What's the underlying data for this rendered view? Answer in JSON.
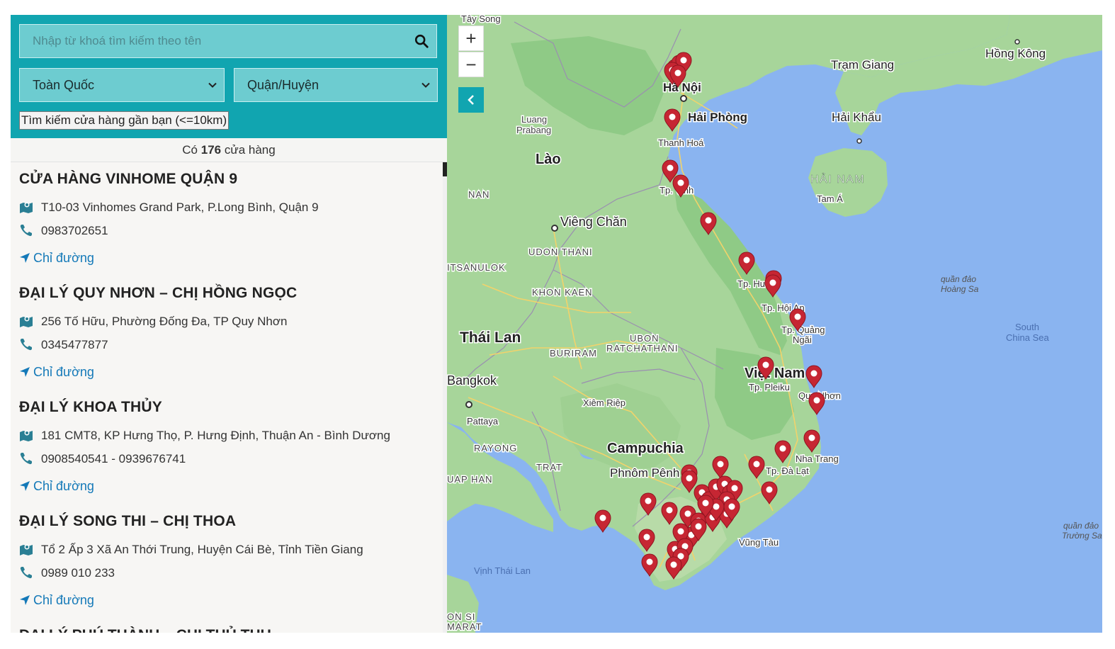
{
  "search": {
    "placeholder": "Nhập từ khoá tìm kiếm theo tên",
    "province_label": "Toàn Quốc",
    "district_label": "Quận/Huyện",
    "nearby_label": "Tìm kiếm cửa hàng gần bạn (<=10km)"
  },
  "count": {
    "prefix": "Có",
    "value": "176",
    "suffix": "cửa hàng"
  },
  "stores": [
    {
      "name": "CỬA HÀNG VINHOME QUẬN 9",
      "address": "T10-03 Vinhomes Grand Park, P.Long Bình, Quận 9",
      "phone": "0983702651",
      "directions": "Chỉ đường"
    },
    {
      "name": "ĐẠI LÝ QUY NHƠN – CHỊ HỒNG NGỌC",
      "address": "256 Tố Hữu, Phường Đống Đa, TP Quy Nhơn",
      "phone": "0345477877",
      "directions": "Chỉ đường"
    },
    {
      "name": "ĐẠI LÝ KHOA THỦY",
      "address": "181 CMT8, KP Hưng Thọ, P. Hưng Định, Thuận An - Bình Dương",
      "phone": "0908540541 - 0939676741",
      "directions": "Chỉ đường"
    },
    {
      "name": "ĐẠI LÝ SONG THI – CHỊ THOA",
      "address": "Tổ 2 Ấp 3 Xã An Thới Trung, Huyện Cái Bè, Tỉnh Tiền Giang",
      "phone": "0989 010 233",
      "directions": "Chỉ đường"
    }
  ],
  "partial_store_name": "ĐẠI LÝ PHÚ THÀNH – CHỊ THỦ THU",
  "map": {
    "zoom_in": "+",
    "zoom_out": "−",
    "labels": {
      "hanoi": "Hà Nội",
      "haiphong": "Hải Phòng",
      "thanhhoa": "Thanh Hoá",
      "lao": "Lào",
      "nan": "NAN",
      "luang1": "Luang",
      "luang2": "Prabang",
      "vientiane": "Viêng Chăn",
      "udon": "UDON THANI",
      "phitsanulok": "ITSANULOK",
      "khonkaen": "KHON KAEN",
      "thailand": "Thái Lan",
      "ubon1": "UBON",
      "ubon2": "RATCHATHANI",
      "buriram": "BURIRAM",
      "bangkok": "Bangkok",
      "siemreap": "Xiêm Riệp",
      "pattaya": "Pattaya",
      "rayong": "RAYONG",
      "cambodia": "Campuchia",
      "phnompenh": "Phnôm Pênh",
      "trat": "TRAT",
      "vietnam": "Việt Nam",
      "pleiku": "Tp. Pleiku",
      "quynhon": "Quy Nhơn",
      "nhatrang": "Nha Trang",
      "dalat": "Tp. Đà Lạt",
      "vungtau": "Vũng Tàu",
      "hue": "Tp. Huế",
      "hoian": "Tp. Hội An",
      "quangngai1": "Tp. Quảng",
      "quangngai2": "Ngãi",
      "vinh": "Tp. Vinh",
      "tramgiang": "Trạm Giang",
      "haikhau": "Hải Khẩu",
      "hainam": "HẢI NAM",
      "tama": "Tam Á",
      "hongkong": "Hồng Kông",
      "paracel1": "quần đảo",
      "paracel2": "Hoàng Sa",
      "southchina1": "South",
      "southchina2": "China Sea",
      "spratly1": "quần đảo",
      "spratly2": "Trường Sa",
      "gulf": "Vịnh Thái Lan",
      "taysong": "Tây Song",
      "uaphan": "UAP HAN",
      "onsi": "ON SI",
      "marat": "MARAT"
    }
  }
}
